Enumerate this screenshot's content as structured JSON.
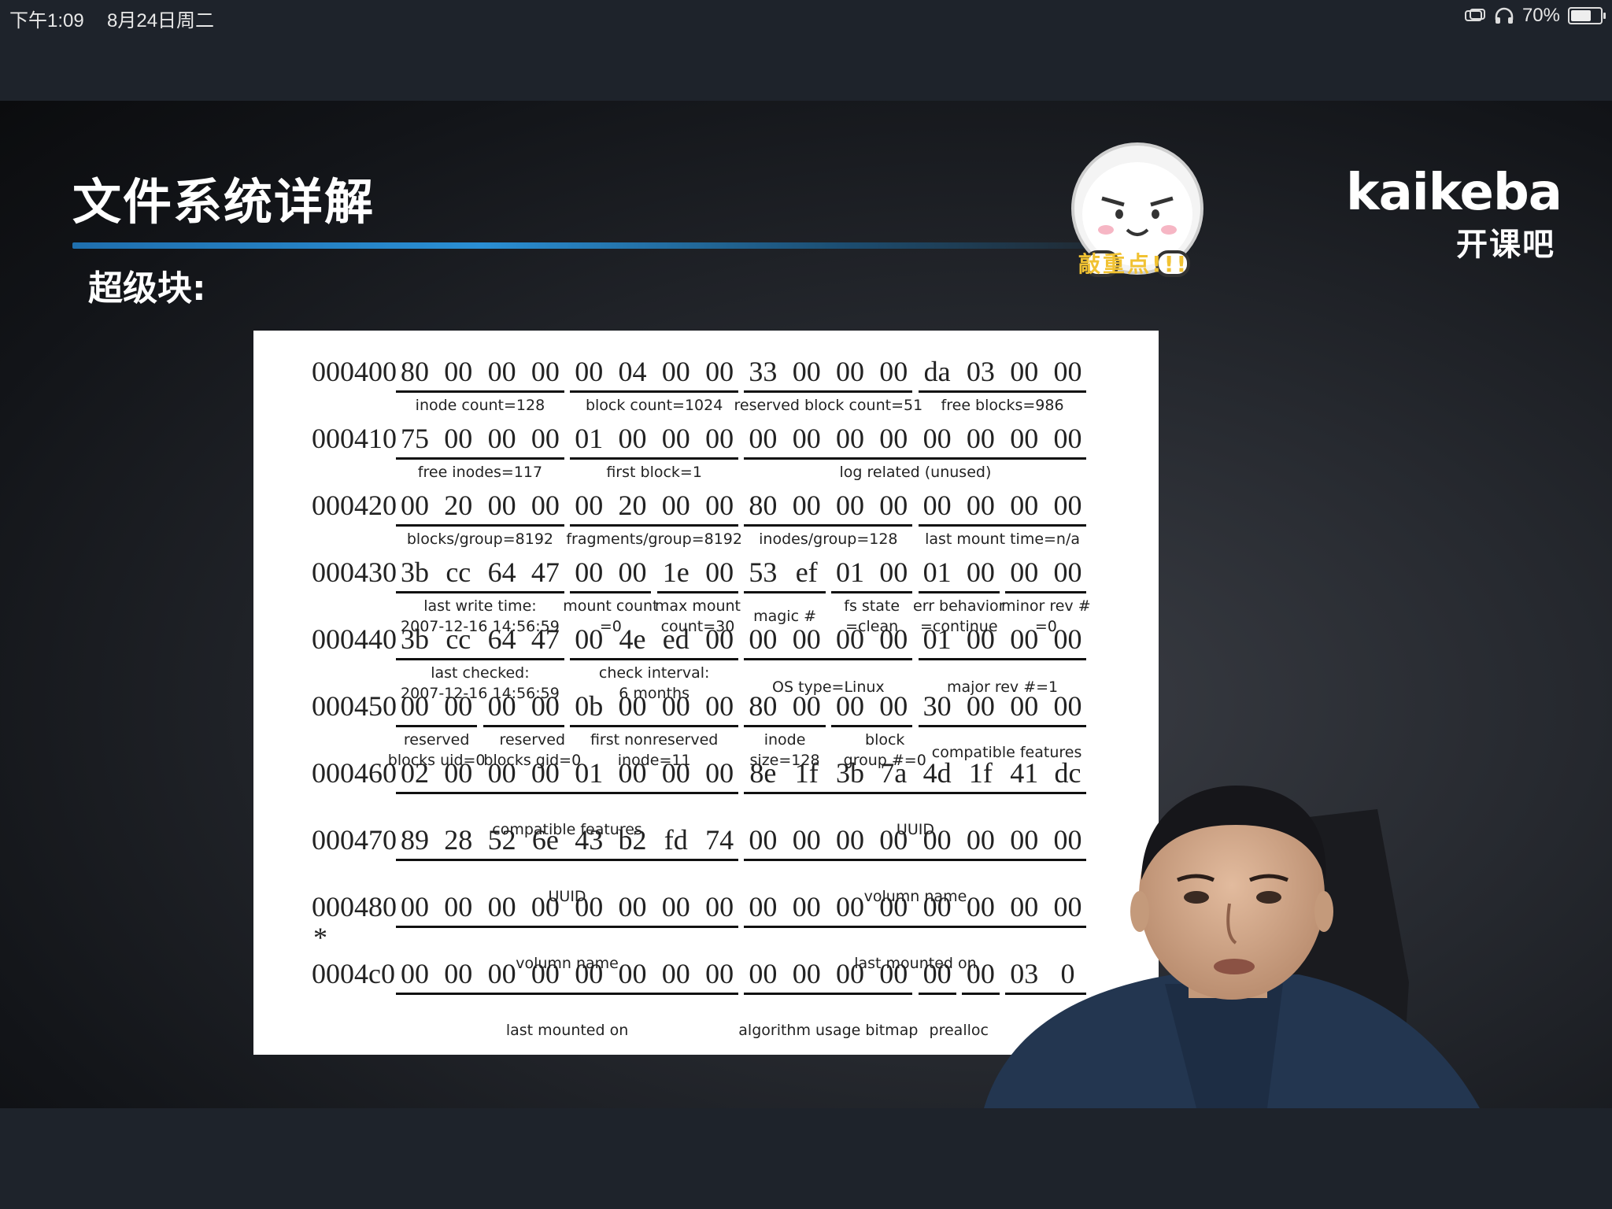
{
  "status_bar": {
    "time": "下午1:09",
    "date": "8月24日周二",
    "battery": "70%",
    "battery_level": 0.7
  },
  "slide": {
    "title": "文件系统详解",
    "subtitle": "超级块:",
    "sticker_text": "敲重点!!!",
    "logo": {
      "name": "kaikeba",
      "subtitle": "开课吧"
    }
  },
  "hexdump": {
    "rows": [
      {
        "addr": "000400",
        "bytes": [
          "80",
          "00",
          "00",
          "00",
          "00",
          "04",
          "00",
          "00",
          "33",
          "00",
          "00",
          "00",
          "da",
          "03",
          "00",
          "00"
        ]
      },
      {
        "addr": "000410",
        "bytes": [
          "75",
          "00",
          "00",
          "00",
          "01",
          "00",
          "00",
          "00",
          "00",
          "00",
          "00",
          "00",
          "00",
          "00",
          "00",
          "00"
        ]
      },
      {
        "addr": "000420",
        "bytes": [
          "00",
          "20",
          "00",
          "00",
          "00",
          "20",
          "00",
          "00",
          "80",
          "00",
          "00",
          "00",
          "00",
          "00",
          "00",
          "00"
        ]
      },
      {
        "addr": "000430",
        "bytes": [
          "3b",
          "cc",
          "64",
          "47",
          "00",
          "00",
          "1e",
          "00",
          "53",
          "ef",
          "01",
          "00",
          "01",
          "00",
          "00",
          "00"
        ]
      },
      {
        "addr": "000440",
        "bytes": [
          "3b",
          "cc",
          "64",
          "47",
          "00",
          "4e",
          "ed",
          "00",
          "00",
          "00",
          "00",
          "00",
          "01",
          "00",
          "00",
          "00"
        ]
      },
      {
        "addr": "000450",
        "bytes": [
          "00",
          "00",
          "00",
          "00",
          "0b",
          "00",
          "00",
          "00",
          "80",
          "00",
          "00",
          "00",
          "30",
          "00",
          "00",
          "00"
        ]
      },
      {
        "addr": "000460",
        "bytes": [
          "02",
          "00",
          "00",
          "00",
          "01",
          "00",
          "00",
          "00",
          "8e",
          "1f",
          "3b",
          "7a",
          "4d",
          "1f",
          "41",
          "dc"
        ]
      },
      {
        "addr": "000470",
        "bytes": [
          "89",
          "28",
          "52",
          "6e",
          "43",
          "b2",
          "fd",
          "74",
          "00",
          "00",
          "00",
          "00",
          "00",
          "00",
          "00",
          "00"
        ]
      },
      {
        "addr": "000480",
        "bytes": [
          "00",
          "00",
          "00",
          "00",
          "00",
          "00",
          "00",
          "00",
          "00",
          "00",
          "00",
          "00",
          "00",
          "00",
          "00",
          "00"
        ]
      },
      {
        "addr": "0004c0",
        "bytes": [
          "00",
          "00",
          "00",
          "00",
          "00",
          "00",
          "00",
          "00",
          "00",
          "00",
          "00",
          "00",
          "00",
          "00",
          "03",
          "0"
        ]
      }
    ],
    "star": "*",
    "annotations": {
      "inode_count": "inode count=128",
      "block_count": "block count=1024",
      "reserved_block_count": "reserved block count=51",
      "free_blocks": "free blocks=986",
      "free_inodes": "free inodes=117",
      "first_block": "first block=1",
      "log_related": "log related (unused)",
      "blocks_per_group": "blocks/group=8192",
      "fragments_per_group": "fragments/group=8192",
      "inodes_per_group": "inodes/group=128",
      "last_mount_time": "last mount time=n/a",
      "last_write_time_1": "last write time:",
      "last_write_time_2": "2007-12-16 14:56:59",
      "mount_count_1": "mount count",
      "mount_count_2": "=0",
      "max_mount_1": "max mount",
      "max_mount_2": "count=30",
      "magic": "magic #",
      "fs_state_1": "fs state",
      "fs_state_2": "=clean",
      "err_behavior_1": "err behavior",
      "err_behavior_2": "=continue",
      "minor_rev_1": "minor rev #",
      "minor_rev_2": "=0",
      "last_checked_1": "last checked:",
      "last_checked_2": "2007-12-16 14:56:59",
      "check_interval_1": "check interval:",
      "check_interval_2": "6 months",
      "os_type": "OS type=Linux",
      "major_rev": "major rev #=1",
      "reserved_uid_1": "reserved",
      "reserved_uid_2": "blocks uid=0",
      "reserved_gid_1": "reserved",
      "reserved_gid_2": "blocks gid=0",
      "first_nonreserved_1": "first nonreserved",
      "first_nonreserved_2": "inode=11",
      "inode_size_1": "inode",
      "inode_size_2": "size=128",
      "block_group_1": "block",
      "block_group_2": "group #=0",
      "compat_features_a": "compatible features",
      "compat_features_b": "compatible features",
      "uuid_a": "UUID",
      "uuid_b": "UUID",
      "volume_name_a": "volumn name",
      "volume_name_b": "volumn name",
      "last_mounted_a": "last mounted on",
      "last_mounted_b": "last mounted on",
      "algorithm_bitmap": "algorithm usage bitmap",
      "prealloc": "prealloc"
    }
  }
}
